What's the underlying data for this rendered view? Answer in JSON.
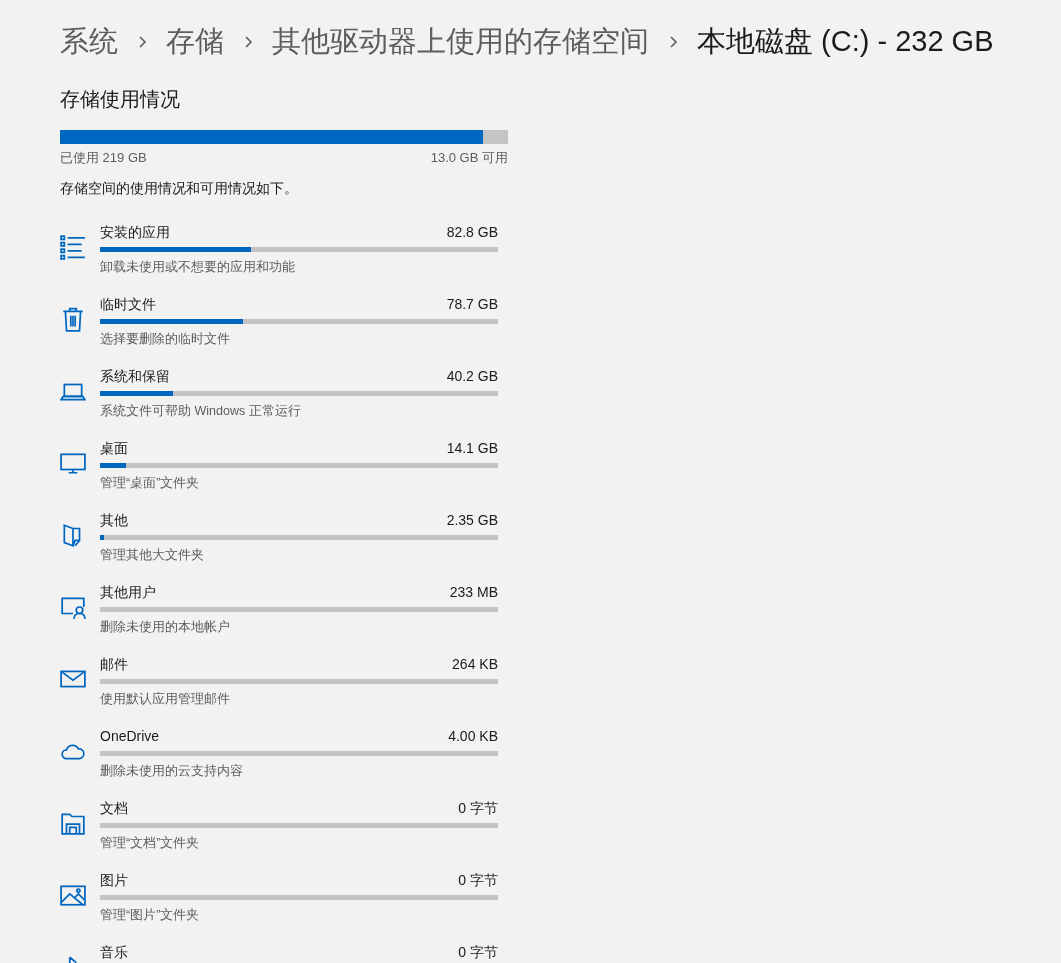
{
  "breadcrumb": [
    {
      "label": "系统",
      "selected": false
    },
    {
      "label": "存储",
      "selected": false
    },
    {
      "label": "其他驱动器上使用的存储空间",
      "selected": false
    },
    {
      "label": "本地磁盘 (C:) - 232 GB",
      "selected": true
    }
  ],
  "usage": {
    "title": "存储使用情况",
    "level": 0.944,
    "used": "已使用 219 GB",
    "free": "13.0 GB 可用",
    "description": "存储空间的使用情况和可用情况如下。"
  },
  "categories": [
    {
      "name": "安装的应用",
      "size": "82.8 GB",
      "level": 0.38,
      "description": "卸载未使用或不想要的应用和功能"
    },
    {
      "name": "临时文件",
      "size": "78.7 GB",
      "level": 0.36,
      "description": "选择要删除的临时文件"
    },
    {
      "name": "系统和保留",
      "size": "40.2 GB",
      "level": 0.184,
      "description": "系统文件可帮助 Windows 正常运行"
    },
    {
      "name": "桌面",
      "size": "14.1 GB",
      "level": 0.065,
      "description": "管理“桌面”文件夹"
    },
    {
      "name": "其他",
      "size": "2.35 GB",
      "level": 0.01,
      "description": "管理其他大文件夹"
    },
    {
      "name": "其他用户",
      "size": "233 MB",
      "level": 0,
      "description": "删除未使用的本地帐户"
    },
    {
      "name": "邮件",
      "size": "264 KB",
      "level": 0,
      "description": "使用默认应用管理邮件"
    },
    {
      "name": "OneDrive",
      "size": "4.00 KB",
      "level": 0,
      "description": "删除未使用的云支持内容"
    },
    {
      "name": "文档",
      "size": "0 字节",
      "level": 0,
      "description": "管理“文档”文件夹"
    },
    {
      "name": "图片",
      "size": "0 字节",
      "level": 0,
      "description": "管理“图片”文件夹"
    },
    {
      "name": "音乐",
      "size": "0 字节"
    }
  ]
}
